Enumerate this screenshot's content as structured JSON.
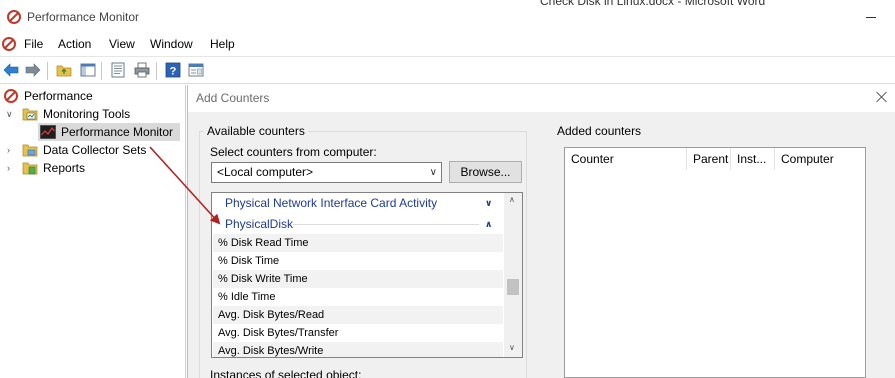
{
  "window": {
    "title": "Performance Monitor",
    "background_title": "Check Disk in Linux.docx - Microsoft Word"
  },
  "menu": [
    "File",
    "Action",
    "View",
    "Window",
    "Help"
  ],
  "tree": {
    "root": "Performance",
    "monitoring_tools": "Monitoring Tools",
    "performance_monitor": "Performance Monitor",
    "data_collector_sets": "Data Collector Sets",
    "reports": "Reports"
  },
  "dialog": {
    "title": "Add Counters",
    "available_label": "Available counters",
    "select_from_label": "Select counters from computer:",
    "computer_value": "<Local computer>",
    "browse_label": "Browse...",
    "categories": [
      {
        "name": "Physical Network Interface Card Activity",
        "expanded": false
      },
      {
        "name": "PhysicalDisk",
        "expanded": true
      }
    ],
    "counters": [
      "% Disk Read Time",
      "% Disk Time",
      "% Disk Write Time",
      "% Idle Time",
      "Avg. Disk Bytes/Read",
      "Avg. Disk Bytes/Transfer",
      "Avg. Disk Bytes/Write"
    ],
    "instances_label": "Instances of selected object:",
    "added_label": "Added counters",
    "added_columns": [
      "Counter",
      "Parent",
      "Inst...",
      "Computer"
    ]
  },
  "colors": {
    "category_text": "#1f3a93",
    "arrow": "#b22222",
    "selected_row": "#d9d9d9"
  }
}
